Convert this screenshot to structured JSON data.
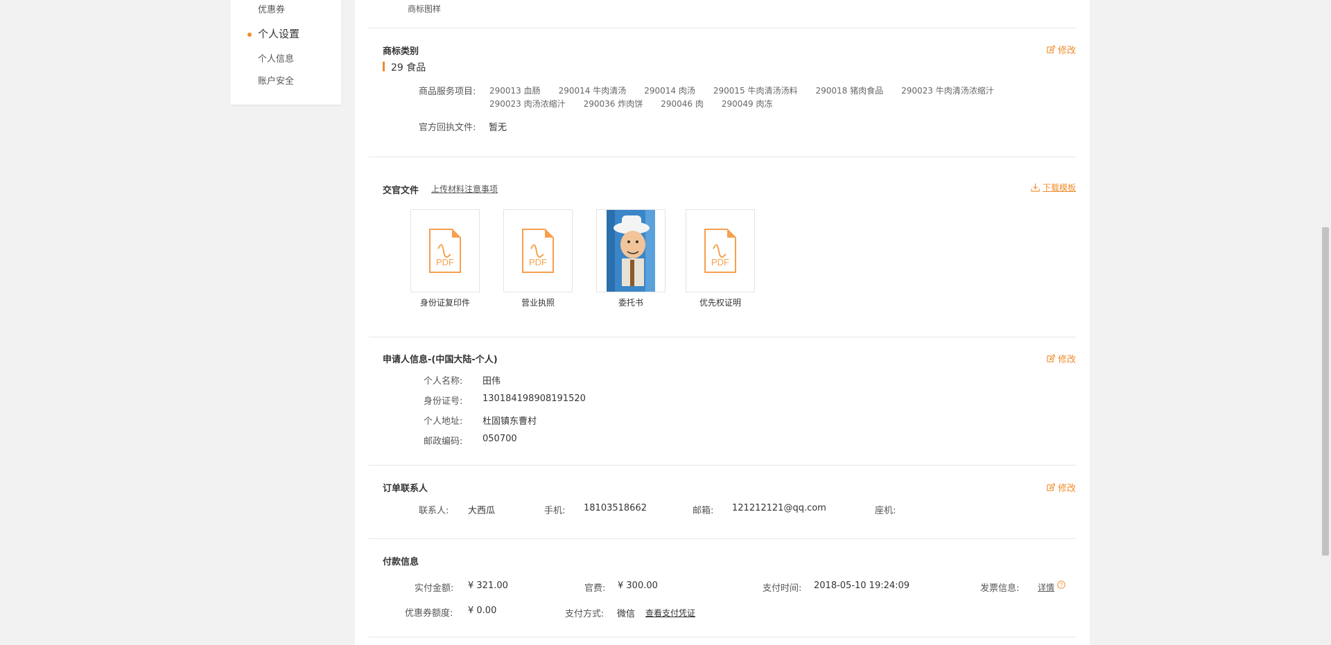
{
  "sidebar": {
    "top_item": "优惠券",
    "section": "个人设置",
    "items": [
      "个人信息",
      "账户安全"
    ]
  },
  "top_caption": "商标图样",
  "category": {
    "title": "商标类别",
    "edit": "修改",
    "class_label": "29 食品",
    "services_label": "商品服务项目:",
    "services_row1": [
      "290013 血肠",
      "290014 牛肉清汤",
      "290014 肉汤",
      "290015 牛肉清汤汤料",
      "290018 猪肉食品",
      "290023 牛肉清汤浓缩汁"
    ],
    "services_row2": [
      "290023 肉汤浓缩汁",
      "290036 炸肉饼",
      "290046 肉",
      "290049 肉冻"
    ],
    "receipt_label": "官方回执文件:",
    "receipt_value": "暂无"
  },
  "docs": {
    "title": "交官文件",
    "notice_link": "上传材料注意事项",
    "download": "下载模板",
    "files": [
      {
        "caption": "身份证复印件",
        "type": "PDF"
      },
      {
        "caption": "营业执照",
        "type": "PDF"
      },
      {
        "caption": "委托书",
        "type": "image"
      },
      {
        "caption": "优先权证明",
        "type": "PDF"
      }
    ]
  },
  "applicant": {
    "title": "申请人信息-(中国大陆-个人)",
    "edit": "修改",
    "name_label": "个人名称:",
    "name": "田伟",
    "id_label": "身份证号:",
    "id": "130184198908191520",
    "address_label": "个人地址:",
    "address": "杜固镇东曹村",
    "zip_label": "邮政编码:",
    "zip": "050700"
  },
  "contact": {
    "title": "订单联系人",
    "edit": "修改",
    "person_label": "联系人:",
    "person": "大西瓜",
    "phone_label": "手机:",
    "phone": "18103518662",
    "email_label": "邮箱:",
    "email": "121212121@qq.com",
    "landline_label": "座机:"
  },
  "payment": {
    "title": "付款信息",
    "paid_label": "实付金额:",
    "paid": "¥ 321.00",
    "fee_label": "官费:",
    "fee": "¥ 300.00",
    "time_label": "支付时间:",
    "time": "2018-05-10 19:24:09",
    "invoice_label": "发票信息:",
    "invoice_link": "详情",
    "coupon_label": "优惠券额度:",
    "coupon": "¥ 0.00",
    "method_label": "支付方式:",
    "method": "微信",
    "voucher_link": "查看支付凭证"
  },
  "colors": {
    "accent": "#f08c2a",
    "pdf": "#f6a04d"
  }
}
